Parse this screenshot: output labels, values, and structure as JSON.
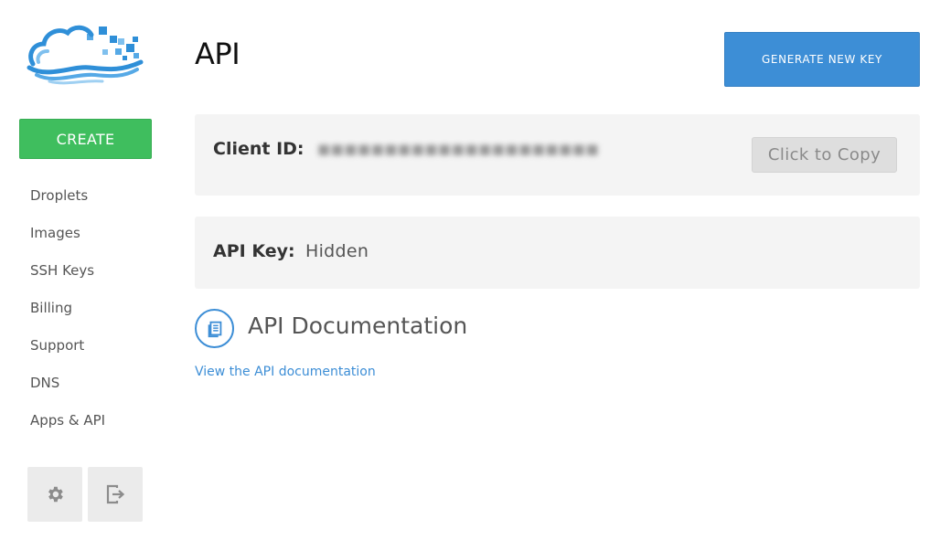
{
  "brand": {
    "logo_icon": "cloud-logo-icon",
    "colors": {
      "primary_blue": "#3d8ed6",
      "logo_blue": "#2f8fd8",
      "create_green": "#3fbe5e"
    }
  },
  "sidebar": {
    "create_label": "CREATE",
    "items": [
      {
        "label": "Droplets"
      },
      {
        "label": "Images"
      },
      {
        "label": "SSH Keys"
      },
      {
        "label": "Billing"
      },
      {
        "label": "Support"
      },
      {
        "label": "DNS"
      },
      {
        "label": "Apps & API"
      }
    ],
    "settings_icon": "gear-icon",
    "logout_icon": "logout-icon"
  },
  "header": {
    "title": "API",
    "generate_label": "GENERATE NEW KEY"
  },
  "client": {
    "label": "Client ID:",
    "copy_label": "Click to Copy"
  },
  "apikey": {
    "label": "API Key:",
    "value": "Hidden"
  },
  "docs": {
    "icon": "document-icon",
    "title": "API Documentation",
    "link": "View the API documentation"
  }
}
